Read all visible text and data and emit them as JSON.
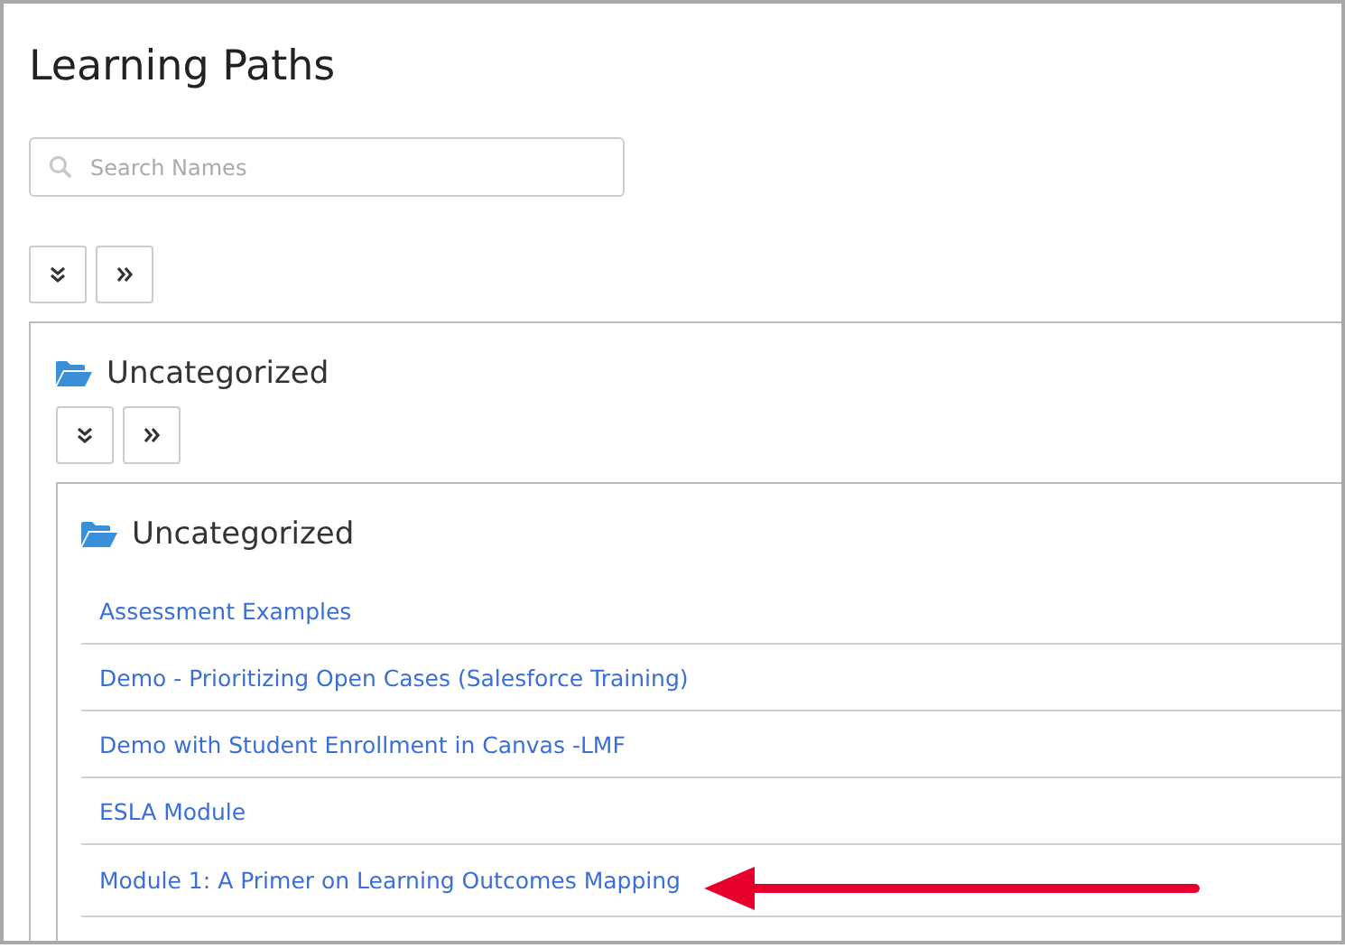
{
  "page": {
    "title": "Learning Paths"
  },
  "search": {
    "placeholder": "Search Names"
  },
  "toolbar": [
    {
      "kind": "expand-all"
    },
    {
      "kind": "expand"
    }
  ],
  "category": {
    "name": "Uncategorized",
    "expanded": true,
    "toolbar": [
      {
        "kind": "expand-all"
      },
      {
        "kind": "expand"
      }
    ],
    "subcategory": {
      "name": "Uncategorized",
      "expanded": true,
      "items": [
        {
          "label": "Assessment Examples"
        },
        {
          "label": "Demo - Prioritizing Open Cases (Salesforce Training)"
        },
        {
          "label": "Demo with Student Enrollment in Canvas -LMF"
        },
        {
          "label": "ESLA Module"
        },
        {
          "label": "Module 1: A Primer on Learning Outcomes Mapping"
        }
      ]
    }
  }
}
